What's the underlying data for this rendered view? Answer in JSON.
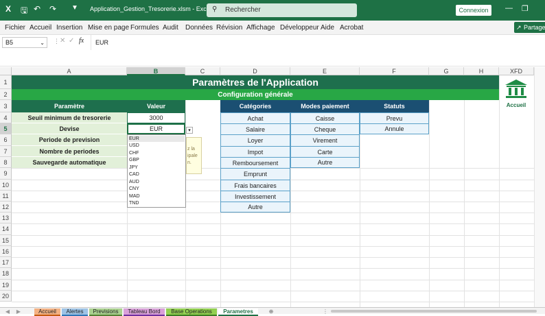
{
  "window": {
    "file_title": "Application_Gestion_Tresorerie.xlsm",
    "app_suffix": "- Excel",
    "search_placeholder": "Rechercher",
    "connexion_label": "Connexion"
  },
  "menu": {
    "items": [
      "Fichier",
      "Accueil",
      "Insertion",
      "Mise en page",
      "Formules",
      "Audit",
      "Données",
      "Révision",
      "Affichage",
      "Développeur",
      "Aide",
      "Acrobat"
    ],
    "share_label": "Partager"
  },
  "formula_bar": {
    "name_box": "B5",
    "fx": "fx",
    "value": "EUR"
  },
  "columns": [
    "A",
    "B",
    "C",
    "D",
    "E",
    "F",
    "G",
    "H",
    "XFD"
  ],
  "rows": [
    "1",
    "2",
    "3",
    "4",
    "5",
    "6",
    "7",
    "8",
    "9",
    "10",
    "11",
    "12",
    "13",
    "14",
    "15",
    "16"
  ],
  "sheet": {
    "title": "Paramètres de l'Application",
    "subtitle": "Configuration générale",
    "param_header": "Paramètre",
    "value_header": "Valeur",
    "params": [
      {
        "label": "Seuil minimum de tresorerie",
        "value": "3000"
      },
      {
        "label": "Devise",
        "value": "EUR"
      },
      {
        "label": "Periode de prevision",
        "value": ""
      },
      {
        "label": "Nombre de periodes",
        "value": ""
      },
      {
        "label": "Sauvegarde automatique",
        "value": ""
      }
    ],
    "categories_header": "Catégories",
    "categories": [
      "Achat",
      "Salaire",
      "Loyer",
      "Impot",
      "Remboursement",
      "Emprunt",
      "Frais bancaires",
      "Investissement",
      "Autre"
    ],
    "payment_header": "Modes paiement",
    "payment_modes": [
      "Caisse",
      "Cheque",
      "Virement",
      "Carte",
      "Autre"
    ],
    "status_header": "Statuts",
    "statuses": [
      "Prevu",
      "Annule"
    ],
    "tooltip_lines": [
      "z la",
      "ipale",
      "n."
    ],
    "home_button_label": "Accueil"
  },
  "dropdown": {
    "options": [
      "EUR",
      "USD",
      "CHF",
      "GBP",
      "JPY",
      "CAD",
      "AUD",
      "CNY",
      "MAD",
      "TND"
    ]
  },
  "tabs": [
    {
      "label": "Accueil",
      "color": "#f4b183"
    },
    {
      "label": "Alertes",
      "color": "#9dc3e6"
    },
    {
      "label": "Previsions",
      "color": "#a9d18e"
    },
    {
      "label": "Tableau Bord",
      "color": "#d9a0d9"
    },
    {
      "label": "Base Operations",
      "color": "#92d050"
    },
    {
      "label": "Parametres",
      "color": "#ffffff"
    }
  ],
  "colors": {
    "excel_green": "#1e7145",
    "header_green": "#1e6f4d",
    "navy": "#1b4f72",
    "light_blue": "#eaf4fb"
  }
}
